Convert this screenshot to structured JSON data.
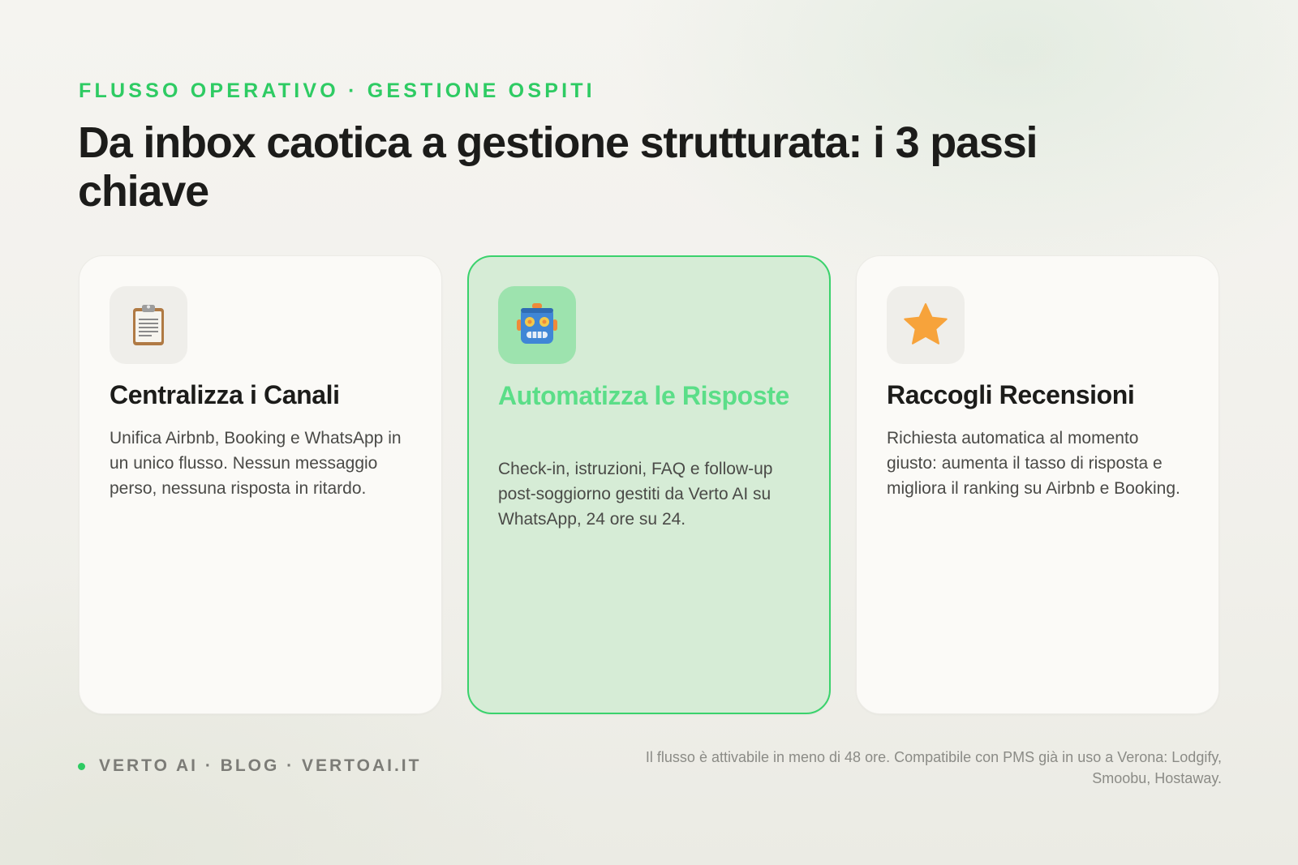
{
  "header": {
    "eyebrow": "FLUSSO OPERATIVO · GESTIONE OSPITI",
    "title": "Da inbox caotica a gestione strutturata: i 3 passi chiave"
  },
  "steps": [
    {
      "icon": "clipboard-icon",
      "title": "Centralizza i Canali",
      "description": "Unifica Airbnb, Booking e WhatsApp in un unico flusso. Nessun messaggio perso, nessuna risposta in ritardo.",
      "highlighted": false
    },
    {
      "icon": "robot-icon",
      "title": "Automatizza le Risposte",
      "description": "Check-in, istruzioni, FAQ e follow-up post-soggiorno gestiti da Verto AI su WhatsApp, 24 ore su 24.",
      "highlighted": true
    },
    {
      "icon": "star-icon",
      "title": "Raccogli Recensioni",
      "description": "Richiesta automatica al momento giusto: aumenta il tasso di risposta e migliora il ranking su Airbnb e Booking.",
      "highlighted": false
    }
  ],
  "footer": {
    "brand": "VERTO AI · BLOG · VERTOAI.IT",
    "note": "Il flusso è attivabile in meno di 48 ore. Compatibile con PMS già in uso a Verona: Lodgify, Smoobu, Hostaway."
  },
  "colors": {
    "accent": "#2ecb63",
    "highlight_card_bg": "#d6ecd6",
    "highlight_title": "#5bde88",
    "text_dark": "#1c1c1a",
    "text_muted": "#7c7c77"
  }
}
